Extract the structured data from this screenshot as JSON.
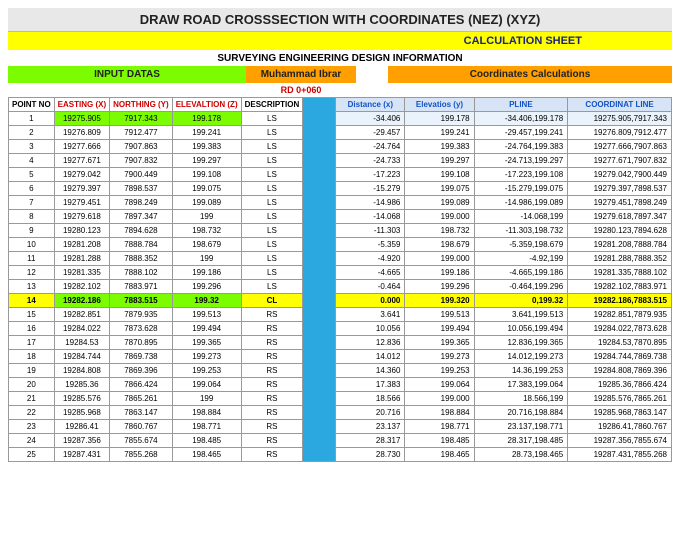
{
  "title": "DRAW ROAD CROSSSECTION WITH COORDINATES (NEZ) (XYZ)",
  "calc_sheet": "CALCULATION SHEET",
  "subtitle": "SURVEYING ENGINEERING DESIGN INFORMATION",
  "input_datas": "INPUT DATAS",
  "author": "Muhammad Ibrar",
  "coord_calc": "Coordinates Calculations",
  "rd": "RD 0+060",
  "left_headers": {
    "point_no": "POINT NO",
    "easting": "EASTING (X)",
    "northing": "NORTHING (Y)",
    "elevation": "ELEVALTION (Z)",
    "description": "DESCRIPTION"
  },
  "right_headers": {
    "dist": "Distance (x)",
    "elev": "Elevatios (y)",
    "pline": "PLINE",
    "coord": "COORDINAT LINE"
  },
  "rows": [
    {
      "pn": "1",
      "e": "19275.905",
      "n": "7917.343",
      "z": "199.178",
      "d": "LS",
      "dx": "-34.406",
      "ey": "199.178",
      "pl": "-34.406,199.178",
      "cl": "19275.905,7917.343",
      "first": true
    },
    {
      "pn": "2",
      "e": "19276.809",
      "n": "7912.477",
      "z": "199.241",
      "d": "LS",
      "dx": "-29.457",
      "ey": "199.241",
      "pl": "-29.457,199.241",
      "cl": "19276.809,7912.477"
    },
    {
      "pn": "3",
      "e": "19277.666",
      "n": "7907.863",
      "z": "199.383",
      "d": "LS",
      "dx": "-24.764",
      "ey": "199.383",
      "pl": "-24.764,199.383",
      "cl": "19277.666,7907.863"
    },
    {
      "pn": "4",
      "e": "19277.671",
      "n": "7907.832",
      "z": "199.297",
      "d": "LS",
      "dx": "-24.733",
      "ey": "199.297",
      "pl": "-24.713,199.297",
      "cl": "19277.671,7907.832"
    },
    {
      "pn": "5",
      "e": "19279.042",
      "n": "7900.449",
      "z": "199.108",
      "d": "LS",
      "dx": "-17.223",
      "ey": "199.108",
      "pl": "-17.223,199.108",
      "cl": "19279.042,7900.449"
    },
    {
      "pn": "6",
      "e": "19279.397",
      "n": "7898.537",
      "z": "199.075",
      "d": "LS",
      "dx": "-15.279",
      "ey": "199.075",
      "pl": "-15.279,199.075",
      "cl": "19279.397,7898.537"
    },
    {
      "pn": "7",
      "e": "19279.451",
      "n": "7898.249",
      "z": "199.089",
      "d": "LS",
      "dx": "-14.986",
      "ey": "199.089",
      "pl": "-14.986,199.089",
      "cl": "19279.451,7898.249"
    },
    {
      "pn": "8",
      "e": "19279.618",
      "n": "7897.347",
      "z": "199",
      "d": "LS",
      "dx": "-14.068",
      "ey": "199.000",
      "pl": "-14.068,199",
      "cl": "19279.618,7897.347"
    },
    {
      "pn": "9",
      "e": "19280.123",
      "n": "7894.628",
      "z": "198.732",
      "d": "LS",
      "dx": "-11.303",
      "ey": "198.732",
      "pl": "-11.303,198.732",
      "cl": "19280.123,7894.628"
    },
    {
      "pn": "10",
      "e": "19281.208",
      "n": "7888.784",
      "z": "198.679",
      "d": "LS",
      "dx": "-5.359",
      "ey": "198.679",
      "pl": "-5.359,198.679",
      "cl": "19281.208,7888.784"
    },
    {
      "pn": "11",
      "e": "19281.288",
      "n": "7888.352",
      "z": "199",
      "d": "LS",
      "dx": "-4.920",
      "ey": "199.000",
      "pl": "-4.92,199",
      "cl": "19281.288,7888.352"
    },
    {
      "pn": "12",
      "e": "19281.335",
      "n": "7888.102",
      "z": "199.186",
      "d": "LS",
      "dx": "-4.665",
      "ey": "199.186",
      "pl": "-4.665,199.186",
      "cl": "19281.335,7888.102"
    },
    {
      "pn": "13",
      "e": "19282.102",
      "n": "7883.971",
      "z": "199.296",
      "d": "LS",
      "dx": "-0.464",
      "ey": "199.296",
      "pl": "-0.464,199.296",
      "cl": "19282.102,7883.971"
    },
    {
      "pn": "14",
      "e": "19282.186",
      "n": "7883.515",
      "z": "199.32",
      "d": "CL",
      "dx": "0.000",
      "ey": "199.320",
      "pl": "0,199.32",
      "cl": "19282.186,7883.515",
      "hl": true
    },
    {
      "pn": "15",
      "e": "19282.851",
      "n": "7879.935",
      "z": "199.513",
      "d": "RS",
      "dx": "3.641",
      "ey": "199.513",
      "pl": "3.641,199.513",
      "cl": "19282.851,7879.935"
    },
    {
      "pn": "16",
      "e": "19284.022",
      "n": "7873.628",
      "z": "199.494",
      "d": "RS",
      "dx": "10.056",
      "ey": "199.494",
      "pl": "10.056,199.494",
      "cl": "19284.022,7873.628"
    },
    {
      "pn": "17",
      "e": "19284.53",
      "n": "7870.895",
      "z": "199.365",
      "d": "RS",
      "dx": "12.836",
      "ey": "199.365",
      "pl": "12.836,199.365",
      "cl": "19284.53,7870.895"
    },
    {
      "pn": "18",
      "e": "19284.744",
      "n": "7869.738",
      "z": "199.273",
      "d": "RS",
      "dx": "14.012",
      "ey": "199.273",
      "pl": "14.012,199.273",
      "cl": "19284.744,7869.738"
    },
    {
      "pn": "19",
      "e": "19284.808",
      "n": "7869.396",
      "z": "199.253",
      "d": "RS",
      "dx": "14.360",
      "ey": "199.253",
      "pl": "14.36,199.253",
      "cl": "19284.808,7869.396"
    },
    {
      "pn": "20",
      "e": "19285.36",
      "n": "7866.424",
      "z": "199.064",
      "d": "RS",
      "dx": "17.383",
      "ey": "199.064",
      "pl": "17.383,199.064",
      "cl": "19285.36,7866.424"
    },
    {
      "pn": "21",
      "e": "19285.576",
      "n": "7865.261",
      "z": "199",
      "d": "RS",
      "dx": "18.566",
      "ey": "199.000",
      "pl": "18.566,199",
      "cl": "19285.576,7865.261"
    },
    {
      "pn": "22",
      "e": "19285.968",
      "n": "7863.147",
      "z": "198.884",
      "d": "RS",
      "dx": "20.716",
      "ey": "198.884",
      "pl": "20.716,198.884",
      "cl": "19285.968,7863.147"
    },
    {
      "pn": "23",
      "e": "19286.41",
      "n": "7860.767",
      "z": "198.771",
      "d": "RS",
      "dx": "23.137",
      "ey": "198.771",
      "pl": "23.137,198.771",
      "cl": "19286.41,7860.767"
    },
    {
      "pn": "24",
      "e": "19287.356",
      "n": "7855.674",
      "z": "198.485",
      "d": "RS",
      "dx": "28.317",
      "ey": "198.485",
      "pl": "28.317,198.485",
      "cl": "19287.356,7855.674"
    },
    {
      "pn": "25",
      "e": "19287.431",
      "n": "7855.268",
      "z": "198.465",
      "d": "RS",
      "dx": "28.730",
      "ey": "198.465",
      "pl": "28.73,198.465",
      "cl": "19287.431,7855.268"
    }
  ]
}
